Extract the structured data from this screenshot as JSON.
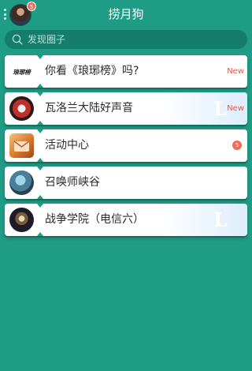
{
  "header": {
    "title": "捞月狗",
    "avatar_badge": "5"
  },
  "search": {
    "placeholder": "发现圈子"
  },
  "circles": [
    {
      "name": "你看《琅琊榜》吗?",
      "tag": "New",
      "logo_text": "琅琊榜"
    },
    {
      "name": "瓦洛兰大陆好声音",
      "tag": "New",
      "watermark": "L"
    },
    {
      "name": "活动中心",
      "badge": "5"
    },
    {
      "name": "召唤师峡谷"
    },
    {
      "name": "战争学院（电信六）",
      "watermark": "L"
    }
  ],
  "colors": {
    "background": "#1e9c86",
    "search_bg": "#147d6b",
    "new_tag": "#e8564a",
    "badge": "#ef6b5a"
  }
}
